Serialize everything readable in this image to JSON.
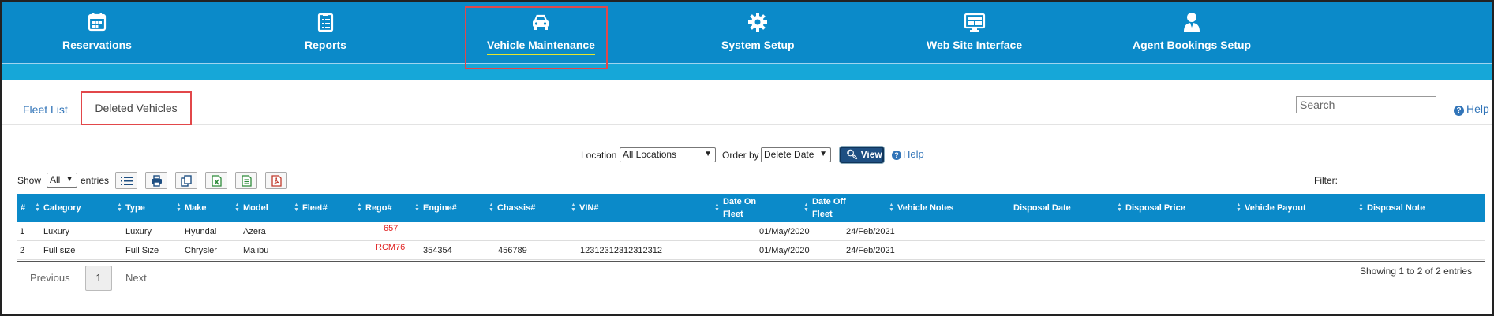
{
  "nav": {
    "items": [
      {
        "label": "Reservations",
        "icon": "calendar-icon"
      },
      {
        "label": "Reports",
        "icon": "clipboard-list-icon"
      },
      {
        "label": "Vehicle Maintenance",
        "icon": "car-icon"
      },
      {
        "label": "System Setup",
        "icon": "gear-icon"
      },
      {
        "label": "Web Site Interface",
        "icon": "monitor-icon"
      },
      {
        "label": "Agent Bookings Setup",
        "icon": "agent-icon"
      }
    ],
    "active": "Vehicle Maintenance"
  },
  "subtabs": {
    "fleet_list": "Fleet List",
    "deleted_vehicles": "Deleted Vehicles",
    "search_placeholder": "Search",
    "help": "Help"
  },
  "filters": {
    "location_label": "Location",
    "location_value": "All Locations",
    "order_by_label": "Order by",
    "order_by_value": "Delete Date",
    "view_button": "View",
    "help": "Help"
  },
  "entries": {
    "show_label": "Show",
    "show_value": "All",
    "entries_label": "entries",
    "filter_label": "Filter:"
  },
  "table": {
    "columns": [
      "#",
      "Category",
      "Type",
      "Make",
      "Model",
      "Fleet#",
      "Rego#",
      "Engine#",
      "Chassis#",
      "VIN#",
      "Date On Fleet",
      "Date Off Fleet",
      "Vehicle Notes",
      "Disposal Date",
      "Disposal Price",
      "Vehicle Payout",
      "Disposal Note"
    ],
    "rows": [
      {
        "num": "1",
        "category": "Luxury",
        "type": "Luxury",
        "make": "Hyundai",
        "model": "Azera",
        "fleet": "",
        "rego": "657",
        "engine": "",
        "chassis": "",
        "vin": "",
        "date_on": "01/May/2020",
        "date_off": "24/Feb/2021"
      },
      {
        "num": "2",
        "category": "Full size",
        "type": "Full Size",
        "make": "Chrysler",
        "model": "Malibu",
        "fleet": "",
        "rego": "RCM76",
        "engine": "354354",
        "chassis": "456789",
        "vin": "12312312312312312",
        "date_on": "01/May/2020",
        "date_off": "24/Feb/2021"
      }
    ]
  },
  "pagination": {
    "previous": "Previous",
    "page": "1",
    "next": "Next",
    "showing": "Showing 1 to 2 of 2 entries"
  },
  "colors": {
    "nav_bg": "#0b8ac9",
    "highlight_box": "#e2474a",
    "link": "#3174b8",
    "rego_red": "#e02020"
  }
}
